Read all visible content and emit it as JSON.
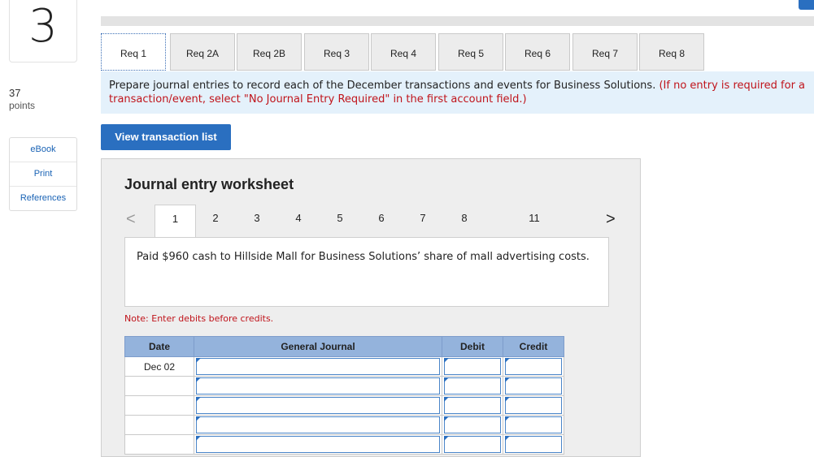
{
  "question": {
    "number": "3",
    "points_value": "37",
    "points_label": "points"
  },
  "side_links": [
    "eBook",
    "Print",
    "References"
  ],
  "tabs": [
    "Req 1",
    "Req 2A",
    "Req 2B",
    "Req 3",
    "Req 4",
    "Req 5",
    "Req 6",
    "Req 7",
    "Req 8"
  ],
  "active_tab": "Req 1",
  "instructions": {
    "main": "Prepare journal entries to record each of the December transactions and events for Business Solutions.",
    "note": "(If no entry is required for a transaction/event, select \"No Journal Entry Required\" in the first account field.)"
  },
  "view_button": "View transaction list",
  "worksheet": {
    "title": "Journal entry worksheet",
    "pages": [
      "1",
      "2",
      "3",
      "4",
      "5",
      "6",
      "7",
      "8",
      "11"
    ],
    "active_page": "1",
    "prev_arrow": "<",
    "next_arrow": ">",
    "description": "Paid $960 cash to Hillside Mall for Business Solutions’ share of mall advertising costs.",
    "note": "Note: Enter debits before credits.",
    "columns": {
      "date": "Date",
      "journal": "General Journal",
      "debit": "Debit",
      "credit": "Credit"
    },
    "rows": [
      {
        "date": "Dec 02"
      },
      {
        "date": ""
      },
      {
        "date": ""
      },
      {
        "date": ""
      },
      {
        "date": ""
      }
    ]
  }
}
